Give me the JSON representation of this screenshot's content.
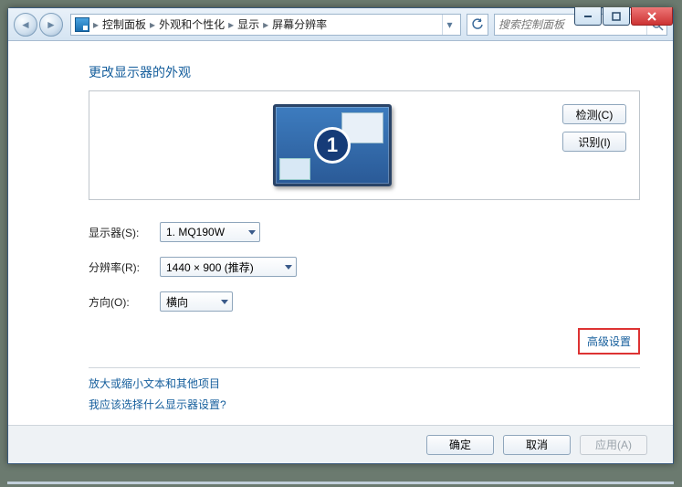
{
  "titlebar": {
    "min": "–",
    "max": "❐",
    "close": "✕"
  },
  "breadcrumb": {
    "items": [
      "控制面板",
      "外观和个性化",
      "显示",
      "屏幕分辨率"
    ],
    "sep": "▸"
  },
  "search": {
    "placeholder": "搜索控制面板"
  },
  "heading": "更改显示器的外观",
  "preview": {
    "detect": "检测(C)",
    "identify": "识别(I)",
    "monitor_num": "1"
  },
  "form": {
    "display_label": "显示器(S):",
    "display_value": "1. MQ190W",
    "resolution_label": "分辨率(R):",
    "resolution_value": "1440 × 900 (推荐)",
    "orientation_label": "方向(O):",
    "orientation_value": "横向"
  },
  "advanced": "高级设置",
  "link1": "放大或缩小文本和其他项目",
  "link2": "我应该选择什么显示器设置?",
  "footer": {
    "ok": "确定",
    "cancel": "取消",
    "apply": "应用(A)"
  }
}
